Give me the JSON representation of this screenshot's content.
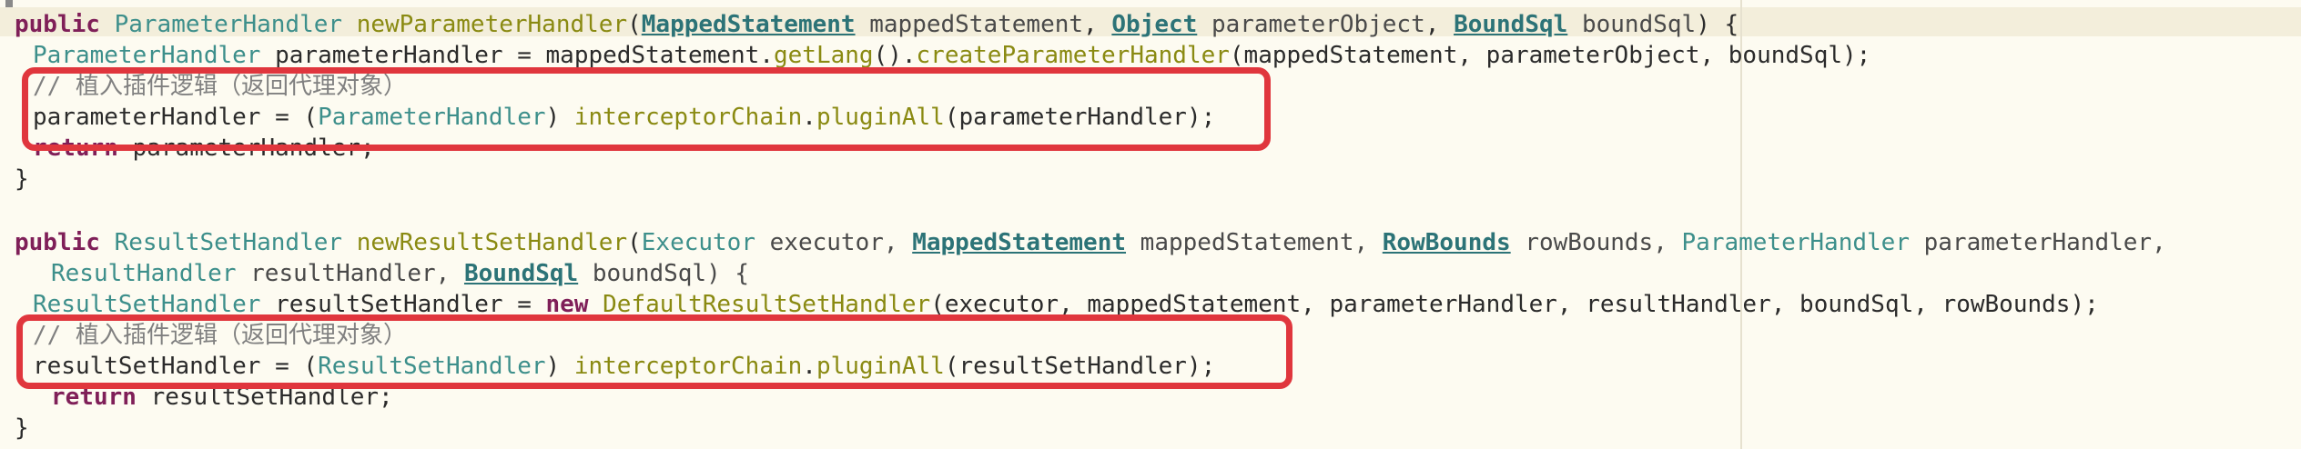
{
  "code": {
    "l1": {
      "kw_public": "public",
      "ret_type": "ParameterHandler",
      "method": "newParameterHandler",
      "open": "(",
      "t1": "MappedStatement",
      "p1": "mappedStatement",
      "s1": ", ",
      "t2": "Object",
      "p2": "parameterObject",
      "s2": ", ",
      "t3": "BoundSql",
      "p3": "boundSql",
      "close": ") {"
    },
    "l2": {
      "type": "ParameterHandler",
      "rest1": " parameterHandler = mappedStatement.",
      "m1": "getLang",
      "rest2": "().",
      "m2": "createParameterHandler",
      "rest3": "(mappedStatement, parameterObject, boundSql);"
    },
    "l3": {
      "comment": "// 植入插件逻辑（返回代理对象）"
    },
    "l4": {
      "a": "parameterHandler = (",
      "type": "ParameterHandler",
      "b": ") ",
      "m1": "interceptorChain",
      "dot": ".",
      "m2": "pluginAll",
      "c": "(parameterHandler);"
    },
    "l5": {
      "kw": "return",
      "rest": " parameterHandler;"
    },
    "l6": {
      "brace": "}"
    },
    "l7": {
      "kw_public": "public",
      "ret_type": "ResultSetHandler",
      "method": "newResultSetHandler",
      "a": "(",
      "t1": "Executor",
      "p1": "executor, ",
      "t2": "MappedStatement",
      "p2": "mappedStatement, ",
      "t3": "RowBounds",
      "p3": "rowBounds, ",
      "t4": "ParameterHandler",
      "p4": "parameterHandler,"
    },
    "l8": {
      "t1": "ResultHandler",
      "p1": "resultHandler, ",
      "t2": "BoundSql",
      "p2": "boundSql) {"
    },
    "l9": {
      "type": "ResultSetHandler",
      "a": " resultSetHandler = ",
      "kw": "new",
      "b": " ",
      "ctor": "DefaultResultSetHandler",
      "c": "(executor, mappedStatement, parameterHandler, resultHandler, boundSql, rowBounds);"
    },
    "l10": {
      "comment": "// 植入插件逻辑（返回代理对象）"
    },
    "l11": {
      "a": "resultSetHandler = (",
      "type": "ResultSetHandler",
      "b": ") ",
      "m1": "interceptorChain",
      "dot": ".",
      "m2": "pluginAll",
      "c": "(resultSetHandler);"
    },
    "l12": {
      "kw": "return",
      "rest": " resultSetHandler;"
    },
    "l13": {
      "brace": "}"
    }
  },
  "colors": {
    "background": "#fdfbf1",
    "keyword": "#7f1f58",
    "type": "#3d8f8b",
    "method": "#8a8a12",
    "comment": "#808080",
    "highlight_box": "#e0363d"
  }
}
